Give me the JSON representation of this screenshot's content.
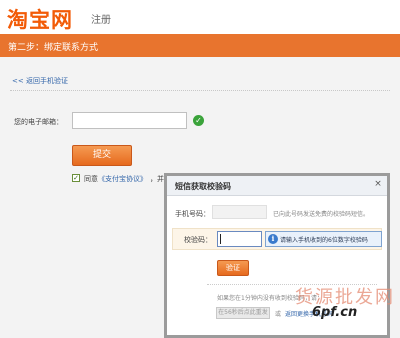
{
  "header": {
    "logo_text": "淘宝网",
    "subtitle": "注册"
  },
  "step_bar": {
    "text": "第二步：绑定联系方式"
  },
  "main": {
    "back_link": "<< 返回手机验证",
    "email_label": "您的电子邮箱：",
    "email_value": "",
    "submit_label": "提交",
    "agree_prefix": "同意",
    "agree_link": "《支付宝协议》",
    "agree_rest": "，并同"
  },
  "modal": {
    "title": "短信获取校验码",
    "phone_label": "手机号码：",
    "phone_value": "",
    "phone_note": "已向此号码发送免费的校验码短信。",
    "code_label": "校验码：",
    "code_value": "",
    "tip_text": "请输入手机收到的6位数字校验码",
    "verify_label": "验证",
    "resend_note": "如果您在1分钟内没有收到校验码，请：",
    "resend_label": "在56秒后点此重发",
    "or_text": "或",
    "change_phone": "返回更换手机号码",
    "close_glyph": "×"
  },
  "watermark": {
    "line1": "货源批发网",
    "line2": "6pf.cn"
  },
  "colors": {
    "brand": "#f25b07",
    "step_bar": "#e8742e",
    "button": "#e66a1e",
    "link": "#3366aa"
  },
  "icons": {
    "success": "check-circle-icon",
    "info": "info-icon",
    "close": "close-icon"
  }
}
